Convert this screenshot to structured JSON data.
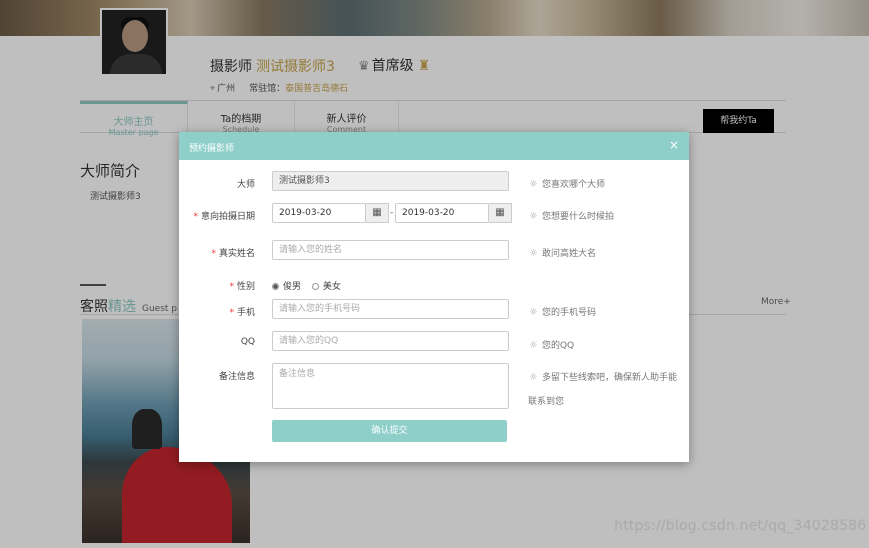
{
  "profile": {
    "role": "摄影师",
    "name": "测试摄影师3",
    "level": "首席级",
    "city": "广州",
    "resident_label": "常驻馆：",
    "resident_value": "泰国普吉岛德石"
  },
  "tabs": [
    {
      "label": "大师主页",
      "sub": "Master page"
    },
    {
      "label": "Ta的档期",
      "sub": "Schedule"
    },
    {
      "label": "新人评价",
      "sub": "Comment"
    }
  ],
  "book_button": "帮我约Ta",
  "intro": {
    "title": "大师简介",
    "text": "测试摄影师3"
  },
  "photos": {
    "title_a": "客照",
    "title_b": "精选",
    "title_en": "Guest p",
    "more": "More+"
  },
  "modal": {
    "title": "预约摄影师",
    "close": "×",
    "master": {
      "label": "大师",
      "value": "测试摄影师3",
      "hint": "您喜欢哪个大师"
    },
    "date": {
      "label": "意向拍摄日期",
      "start": "2019-03-20",
      "end": "2019-03-20",
      "separator": "-",
      "hint": "您想要什么时候拍"
    },
    "name": {
      "label": "真实姓名",
      "placeholder": "请输入您的姓名",
      "hint": "敢问高姓大名"
    },
    "gender": {
      "label": "性别",
      "options": [
        "俊男",
        "美女"
      ],
      "selected": "俊男"
    },
    "phone": {
      "label": "手机",
      "placeholder": "请输入您的手机号码",
      "hint": "您的手机号码"
    },
    "qq": {
      "label": "QQ",
      "placeholder": "请输入您的QQ",
      "hint": "您的QQ"
    },
    "remark": {
      "label": "备注信息",
      "placeholder": "备注信息",
      "hint_line1": "多留下些线索吧，确保新人助手能",
      "hint_line2": "联系到您"
    },
    "submit": "确认提交"
  },
  "watermark": "https://blog.csdn.net/qq_34028586"
}
